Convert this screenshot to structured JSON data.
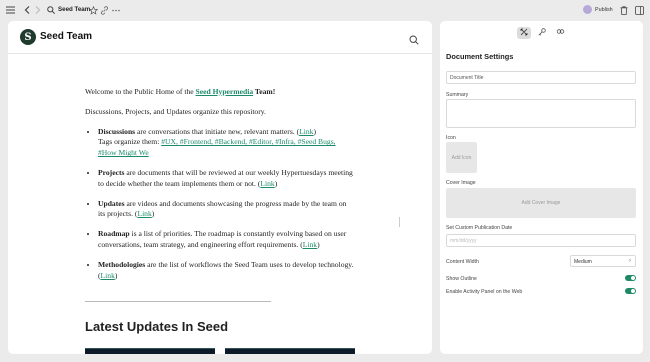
{
  "topbar": {
    "doc_title": "Seed Team",
    "publish_label": "Publish"
  },
  "site": {
    "name": "Seed Team",
    "logo_letter": "S"
  },
  "document": {
    "intro_prefix": "Welcome to the Public Home of the ",
    "intro_link": "Seed Hypermedia",
    "intro_suffix": " Team!",
    "line2": "Discussions, Projects, and Updates organize this repository.",
    "items": [
      {
        "term": "Discussions",
        "text": " are conversations that initiate new, relevant matters. (",
        "link": "Link",
        "close": ")",
        "tags_prefix": "Tags organize them: ",
        "tags": "#UX, #Frontend, #Backend, #Editor, #Infra, #Seed Bugs, #How Might We"
      },
      {
        "term": "Projects",
        "text": " are documents that will be reviewed at our weekly Hypertuesdays meeting to decide whether the team implements them or not. (",
        "link": "Link",
        "close": ")"
      },
      {
        "term": "Updates",
        "text": " are videos and documents showcasing the progress made by the team on its projects. (",
        "link": "Link",
        "close": ")"
      },
      {
        "term": "Roadmap",
        "text": " is a list of priorities. The roadmap is constantly evolving based on user conversations, team strategy, and engineering effort requirements. (",
        "link": "Link",
        "close": ")"
      },
      {
        "term": "Methodologies",
        "text": " are the list of workflows the Seed Team uses to develop technology. (",
        "link": "Link",
        "close": ")"
      }
    ],
    "latest_heading": "Latest Updates In Seed"
  },
  "settings": {
    "title": "Document Settings",
    "doc_title_placeholder": "Document Title",
    "summary_label": "Summary",
    "icon_label": "Icon",
    "add_icon": "Add Icon",
    "cover_label": "Cover Image",
    "add_cover": "Add Cover Image",
    "pub_date_label": "Set Custom Publication Date",
    "pub_date_placeholder": "mm/dd/yyyy",
    "content_width_label": "Content Width",
    "content_width_value": "Medium",
    "show_outline_label": "Show Outline",
    "show_outline_on": true,
    "activity_label": "Enable Activity Panel on the Web",
    "activity_on": true
  }
}
